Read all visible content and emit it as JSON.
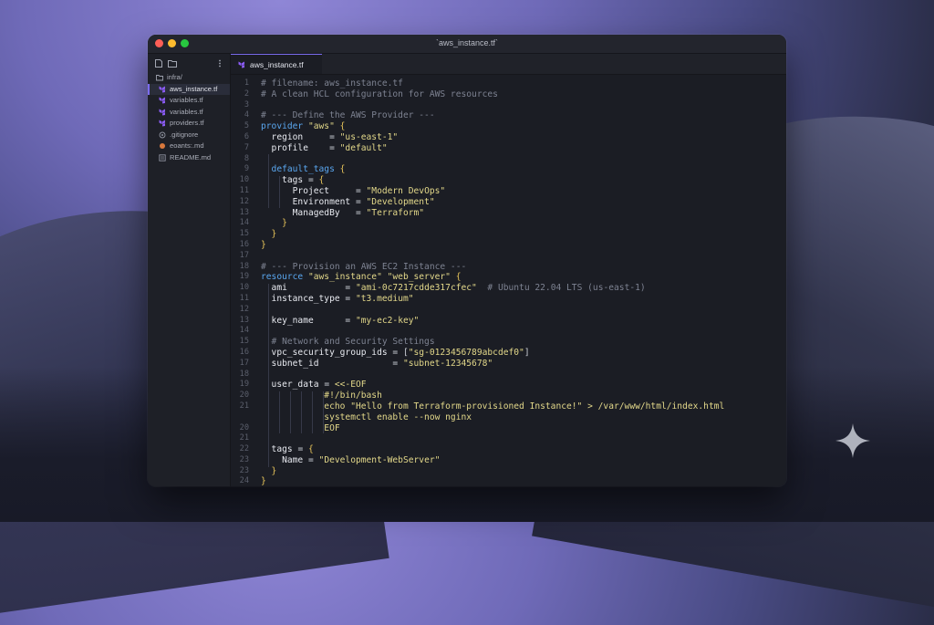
{
  "window": {
    "title": "`aws_instance.tf`"
  },
  "sidebar": {
    "toolbar_icons": [
      "new-file-icon",
      "new-folder-icon",
      "more-options-icon"
    ],
    "folder": "infra/",
    "items": [
      {
        "label": "aws_instance.tf",
        "icon": "terraform-icon",
        "active": true
      },
      {
        "label": "variables.tf",
        "icon": "terraform-icon"
      },
      {
        "label": "variables.tf",
        "icon": "terraform-icon"
      },
      {
        "label": "providers.tf",
        "icon": "terraform-icon"
      },
      {
        "label": ".gitignore",
        "icon": "git-icon"
      },
      {
        "label": "eoants:.md",
        "icon": "markdown-icon"
      },
      {
        "label": "README.md",
        "icon": "readme-icon"
      }
    ]
  },
  "tab": {
    "label": "aws_instance.tf",
    "icon": "terraform-icon"
  },
  "colors": {
    "accent": "#7b6cf0",
    "comment": "#7d8291",
    "keyword": "#5aa7f0",
    "string": "#e3d88a",
    "brace": "#e7c45a",
    "terraform": "#7b42bc"
  },
  "code": [
    {
      "n": "1",
      "parts": [
        [
          "cm",
          "# filename: aws_instance.tf"
        ]
      ]
    },
    {
      "n": "2",
      "parts": [
        [
          "cm",
          "# A clean HCL configuration for AWS resources"
        ]
      ]
    },
    {
      "n": "3",
      "parts": []
    },
    {
      "n": "4",
      "parts": [
        [
          "cm",
          "# --- Define the AWS Provider ---"
        ]
      ]
    },
    {
      "n": "5",
      "parts": [
        [
          "kw",
          "provider "
        ],
        [
          "st",
          "\"aws\" "
        ],
        [
          "br",
          "{"
        ]
      ]
    },
    {
      "n": "6",
      "parts": [
        [
          "pr",
          "  region     "
        ],
        [
          "op",
          "= "
        ],
        [
          "st",
          "\"us-east-1\""
        ]
      ]
    },
    {
      "n": "7",
      "parts": [
        [
          "pr",
          "  profile    "
        ],
        [
          "op",
          "= "
        ],
        [
          "st",
          "\"default\""
        ]
      ]
    },
    {
      "n": "8",
      "parts": []
    },
    {
      "n": "9",
      "parts": [
        [
          "kw",
          "  default_tags "
        ],
        [
          "br",
          "{"
        ]
      ]
    },
    {
      "n": "10",
      "parts": [
        [
          "pr",
          "    tags "
        ],
        [
          "op",
          "= "
        ],
        [
          "br",
          "{"
        ]
      ]
    },
    {
      "n": "11",
      "parts": [
        [
          "pr",
          "      Project     "
        ],
        [
          "op",
          "= "
        ],
        [
          "st",
          "\"Modern DevOps\""
        ]
      ]
    },
    {
      "n": "12",
      "parts": [
        [
          "pr",
          "      Environment "
        ],
        [
          "op",
          "= "
        ],
        [
          "st",
          "\"Development\""
        ]
      ]
    },
    {
      "n": "13",
      "parts": [
        [
          "pr",
          "      ManagedBy   "
        ],
        [
          "op",
          "= "
        ],
        [
          "st",
          "\"Terraform\""
        ]
      ]
    },
    {
      "n": "14",
      "parts": [
        [
          "br",
          "    }"
        ]
      ]
    },
    {
      "n": "15",
      "parts": [
        [
          "br",
          "  }"
        ]
      ]
    },
    {
      "n": "16",
      "parts": [
        [
          "br",
          "}"
        ]
      ]
    },
    {
      "n": "17",
      "parts": []
    },
    {
      "n": "18",
      "parts": [
        [
          "cm",
          "# --- Provision an AWS EC2 Instance ---"
        ]
      ]
    },
    {
      "n": "19",
      "parts": [
        [
          "kw",
          "resource "
        ],
        [
          "st",
          "\"aws_instance\" \"web_server\" "
        ],
        [
          "br",
          "{"
        ]
      ]
    },
    {
      "n": "10",
      "parts": [
        [
          "pr",
          "  ami           "
        ],
        [
          "op",
          "= "
        ],
        [
          "st",
          "\"ami-0c7217cdde317cfec\""
        ],
        [
          "cm",
          "  # Ubuntu 22.04 LTS (us-east-1)"
        ]
      ]
    },
    {
      "n": "11",
      "parts": [
        [
          "pr",
          "  instance_type "
        ],
        [
          "op",
          "= "
        ],
        [
          "st",
          "\"t3.medium\""
        ]
      ]
    },
    {
      "n": "12",
      "parts": []
    },
    {
      "n": "13",
      "parts": [
        [
          "pr",
          "  key_name      "
        ],
        [
          "op",
          "= "
        ],
        [
          "st",
          "\"my-ec2-key\""
        ]
      ]
    },
    {
      "n": "14",
      "parts": []
    },
    {
      "n": "15",
      "parts": [
        [
          "cm",
          "  # Network and Security Settings"
        ]
      ]
    },
    {
      "n": "16",
      "parts": [
        [
          "pr",
          "  vpc_security_group_ids "
        ],
        [
          "op",
          "= "
        ],
        [
          "op",
          "["
        ],
        [
          "st",
          "\"sg-0123456789abcdef0\""
        ],
        [
          "op",
          "]"
        ]
      ]
    },
    {
      "n": "17",
      "parts": [
        [
          "pr",
          "  subnet_id              "
        ],
        [
          "op",
          "= "
        ],
        [
          "st",
          "\"subnet-12345678\""
        ]
      ]
    },
    {
      "n": "18",
      "parts": []
    },
    {
      "n": "19",
      "parts": [
        [
          "pr",
          "  user_data "
        ],
        [
          "op",
          "= "
        ],
        [
          "st",
          "<<-EOF"
        ]
      ]
    },
    {
      "n": "20",
      "parts": [
        [
          "st",
          "            #!/bin/bash"
        ]
      ]
    },
    {
      "n": "21",
      "parts": [
        [
          "st",
          "            echo \"Hello from Terraform-provisioned Instance!\" > /var/www/html/index.html"
        ]
      ]
    },
    {
      "n": "",
      "parts": [
        [
          "st",
          "            systemctl enable --now nginx"
        ]
      ]
    },
    {
      "n": "20",
      "parts": [
        [
          "st",
          "            EOF"
        ]
      ]
    },
    {
      "n": "21",
      "parts": []
    },
    {
      "n": "22",
      "parts": [
        [
          "pr",
          "  tags "
        ],
        [
          "op",
          "= "
        ],
        [
          "br",
          "{"
        ]
      ]
    },
    {
      "n": "23",
      "parts": [
        [
          "pr",
          "    Name "
        ],
        [
          "op",
          "= "
        ],
        [
          "st",
          "\"Development-WebServer\""
        ]
      ]
    },
    {
      "n": "23",
      "parts": [
        [
          "br",
          "  }"
        ]
      ]
    },
    {
      "n": "24",
      "parts": [
        [
          "br",
          "}"
        ]
      ]
    }
  ],
  "decor": {
    "sparkle": "sparkle-icon"
  }
}
